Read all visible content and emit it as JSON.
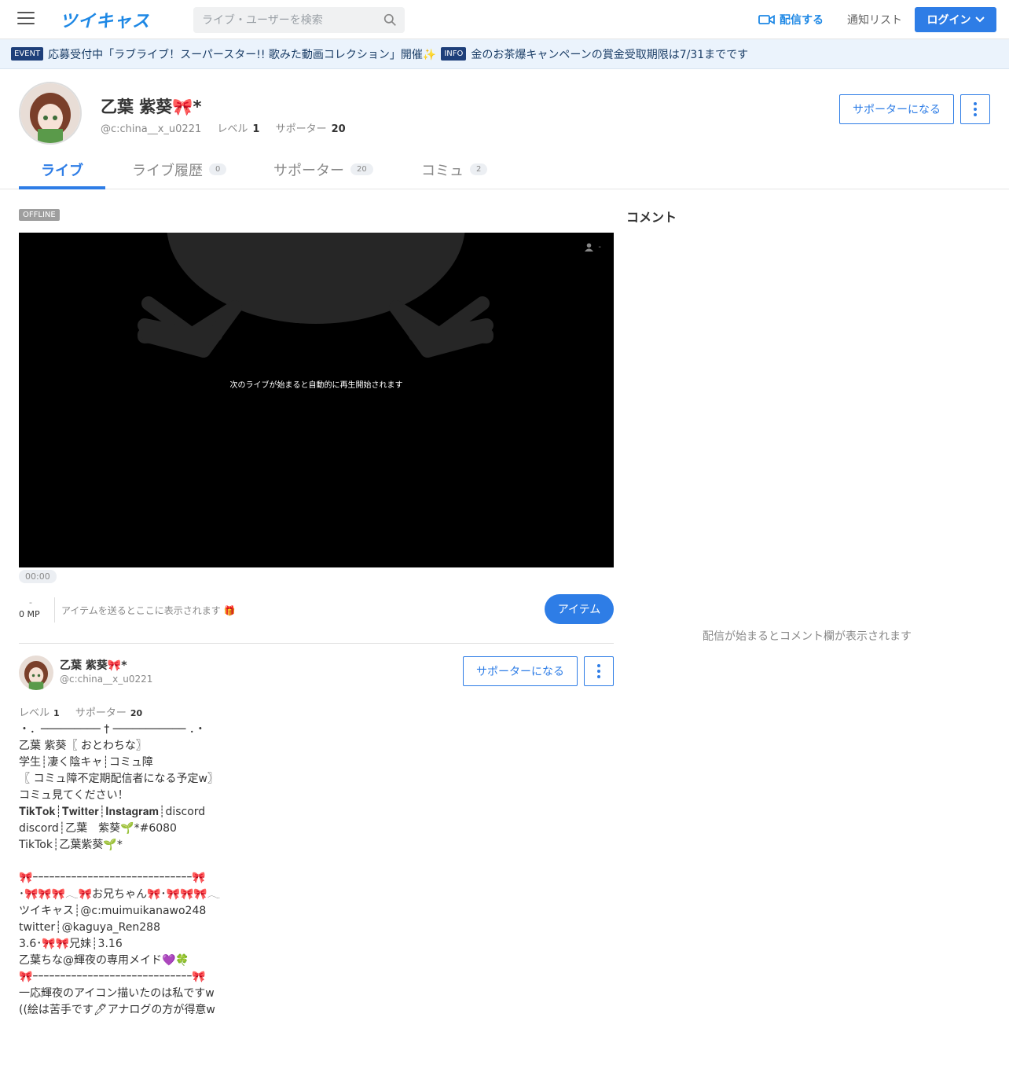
{
  "header": {
    "logo": "ツイキャス",
    "search_placeholder": "ライブ・ユーザーを検索",
    "broadcast_label": "配信する",
    "notif_label": "通知リスト",
    "login_label": "ログイン"
  },
  "infobar": {
    "event_badge": "EVENT",
    "event_text": "応募受付中「ラブライブ！スーパースター!! 歌みた動画コレクション」開催✨",
    "info_badge": "INFO",
    "info_text": "金のお茶爆キャンペーンの賞金受取期限は7/31までです"
  },
  "profile": {
    "name": "乙葉 紫葵🎀*",
    "handle": "@c:china__x_u0221",
    "level_label": "レベル",
    "level": "1",
    "supporter_label": "サポーター",
    "supporters": "20",
    "support_button": "サポーターになる"
  },
  "tabs": [
    {
      "label": "ライブ",
      "count": ""
    },
    {
      "label": "ライブ履歴",
      "count": "0"
    },
    {
      "label": "サポーター",
      "count": "20"
    },
    {
      "label": "コミュ",
      "count": "2"
    }
  ],
  "player": {
    "status": "OFFLINE",
    "message": "次のライブが始まると自動的に再生開始されます",
    "viewers": "-",
    "time": "00:00",
    "mp_dash": "-",
    "mp": "0 MP",
    "item_message": "アイテムを送るとここに表示されます 🎁",
    "item_button": "アイテム"
  },
  "comments": {
    "title": "コメント",
    "empty": "配信が始まるとコメント欄が表示されます"
  },
  "card": {
    "name": "乙葉 紫葵🎀*",
    "handle": "@c:china__x_u0221",
    "level_label": "レベル",
    "level": "1",
    "supporter_label": "サポーター",
    "supporters": "20",
    "support_button": "サポーターになる"
  },
  "bio": [
    "・．───────── † ─────────── ．・",
    "乙葉 紫葵〖 おとわちな〗",
    "学生┊凄く陰キャ┊コミュ障",
    "〖 コミュ障不定期配信者になる予定w〗",
    "コミュ見てください！",
    "𝐓𝐢𝐤𝐓𝐨𝐤┊𝐓𝐰𝐢𝐭𝐭𝐞𝐫┊𝐈𝐧𝐬𝐭𝐚𝐠𝐫𝐚𝐦┊discord",
    "discord┊乙葉　紫葵🌱*#6080",
    "TikTok┊乙葉紫葵🌱*",
    "",
    "🎀ｰｰｰｰｰｰｰｰｰｰｰｰｰｰｰｰｰｰｰｰｰｰｰｰｰｰｰｰｰ🎀",
    "･🎀🎀🎀𓂃🎀お兄ちゃん🎀･🎀🎀🎀𓂃",
    "ツイキャス┊@c:muimuikanawo248",
    "twitter┊@kaguya_Ren288",
    "3.6･🎀🎀兄妹┊3.16",
    "乙葉ちな@輝夜の専用メイド💜🍀",
    "🎀ｰｰｰｰｰｰｰｰｰｰｰｰｰｰｰｰｰｰｰｰｰｰｰｰｰｰｰｰｰ🎀",
    "一応輝夜のアイコン描いたのは私ですw",
    "((絵は苦手です🖊アナログの方が得意w"
  ]
}
